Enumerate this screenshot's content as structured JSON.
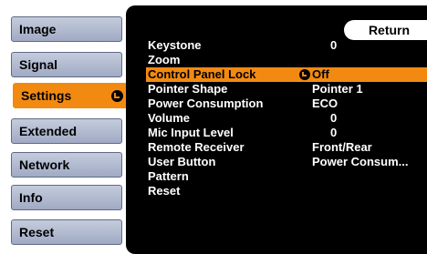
{
  "sidebar": {
    "items": [
      {
        "label": "Image"
      },
      {
        "label": "Signal"
      },
      {
        "label": "Settings",
        "active": true
      },
      {
        "label": "Extended"
      },
      {
        "label": "Network"
      },
      {
        "label": "Info"
      },
      {
        "label": "Reset"
      }
    ]
  },
  "panel": {
    "return_label": "Return",
    "rows": [
      {
        "label": "Keystone",
        "value": "0"
      },
      {
        "label": "Zoom",
        "value": ""
      },
      {
        "label": "Control Panel Lock",
        "value": "Off",
        "selected": true
      },
      {
        "label": "Pointer Shape",
        "value": "Pointer 1"
      },
      {
        "label": "Power Consumption",
        "value": "ECO"
      },
      {
        "label": "Volume",
        "value": "0"
      },
      {
        "label": "Mic Input Level",
        "value": "0"
      },
      {
        "label": "Remote Receiver",
        "value": "Front/Rear"
      },
      {
        "label": "User Button",
        "value": "Power Consum..."
      },
      {
        "label": "Pattern",
        "value": ""
      },
      {
        "label": "Reset",
        "value": ""
      }
    ]
  },
  "colors": {
    "accent": "#f28a12",
    "panel_bg": "#000000",
    "sidebar_button": "#b3bcd1"
  },
  "icons": {
    "enter": "enter-icon"
  }
}
